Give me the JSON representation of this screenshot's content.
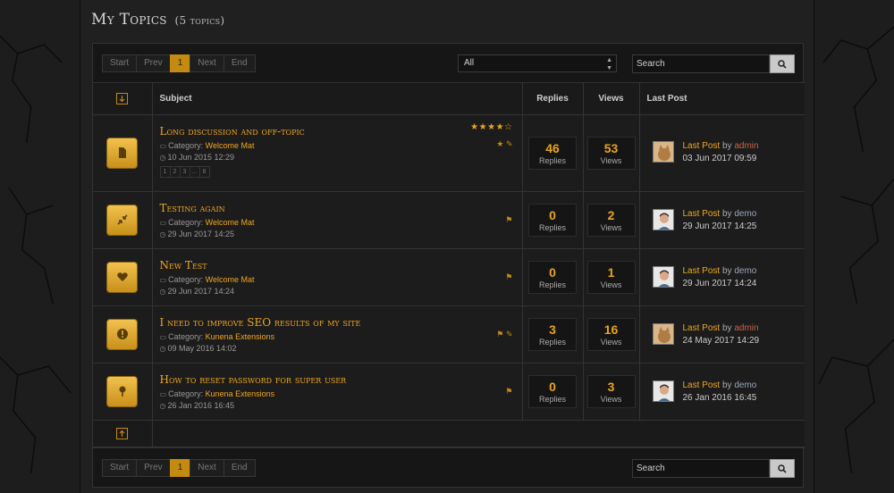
{
  "page": {
    "title": "My Topics",
    "count": "(5 topics)"
  },
  "pager": {
    "start": "Start",
    "prev": "Prev",
    "current": "1",
    "next": "Next",
    "end": "End"
  },
  "filter": {
    "selected": "All"
  },
  "search": {
    "label": "Search",
    "icon": "search-icon"
  },
  "columns": {
    "subject": "Subject",
    "replies": "Replies",
    "views": "Views",
    "last_post": "Last Post"
  },
  "labels": {
    "category_prefix": "Category:",
    "replies": "Replies",
    "views": "Views",
    "last_post": "Last Post",
    "by": "by"
  },
  "topics": [
    {
      "title": "Long discussion and off-topic",
      "category": "Welcome Mat",
      "date": "10 Jun 2015 12:29",
      "icon": "document-icon",
      "rating_stars": 4,
      "pages": [
        "1",
        "2",
        "3",
        "...",
        "8"
      ],
      "badges": [
        "star-icon",
        "paperclip-icon"
      ],
      "replies": "46",
      "views": "53",
      "last_user": "admin",
      "last_date": "03 Jun 2017 09:59"
    },
    {
      "title": "Testing again",
      "category": "Welcome Mat",
      "date": "29 Jun 2017 14:25",
      "icon": "compress-icon",
      "badges": [
        "flag-icon"
      ],
      "replies": "0",
      "views": "2",
      "last_user": "demo",
      "last_date": "29 Jun 2017 14:25"
    },
    {
      "title": "New Test",
      "category": "Welcome Mat",
      "date": "29 Jun 2017 14:24",
      "icon": "heart-icon",
      "badges": [
        "flag-icon"
      ],
      "replies": "0",
      "views": "1",
      "last_user": "demo",
      "last_date": "29 Jun 2017 14:24"
    },
    {
      "title": "I need to improve SEO results of my site",
      "category": "Kunena Extensions",
      "date": "09 May 2016 14:02",
      "icon": "exclamation-icon",
      "badges": [
        "flag-icon",
        "paperclip-icon"
      ],
      "replies": "3",
      "views": "16",
      "last_user": "admin",
      "last_date": "24 May 2017 14:29"
    },
    {
      "title": "How to reset password for super user",
      "category": "Kunena Extensions",
      "date": "26 Jan 2016 16:45",
      "icon": "pin-icon",
      "badges": [
        "flag-icon"
      ],
      "replies": "0",
      "views": "3",
      "last_user": "demo",
      "last_date": "26 Jan 2016 16:45"
    }
  ],
  "colors": {
    "accent": "#f0a71f",
    "admin_name": "#c8634a",
    "demo_name": "#9aa5bd"
  }
}
